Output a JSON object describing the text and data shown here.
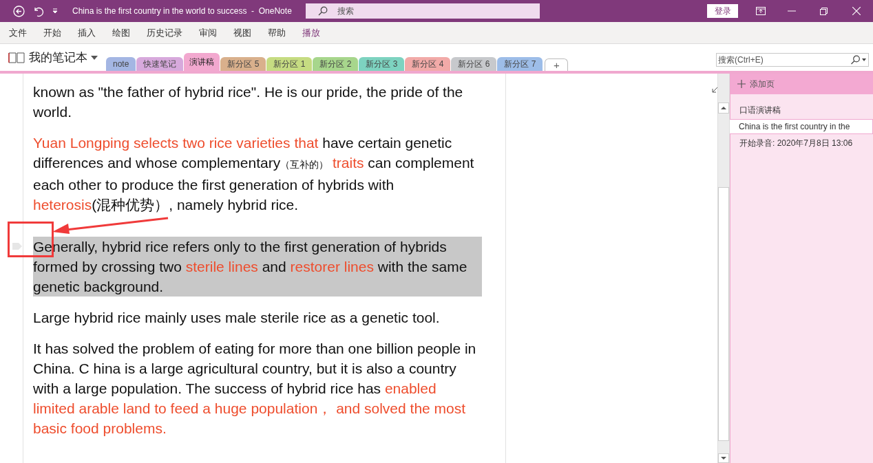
{
  "window": {
    "title": "China is the first country in the world to success  -  OneNote",
    "search_placeholder": "搜索",
    "sign_in": "登录"
  },
  "menu": [
    {
      "label": "文件",
      "selected": false
    },
    {
      "label": "开始",
      "selected": false
    },
    {
      "label": "插入",
      "selected": false
    },
    {
      "label": "绘图",
      "selected": false
    },
    {
      "label": "历史记录",
      "selected": false
    },
    {
      "label": "审阅",
      "selected": false
    },
    {
      "label": "视图",
      "selected": false
    },
    {
      "label": "帮助",
      "selected": false
    },
    {
      "label": "播放",
      "selected": true
    }
  ],
  "notebook": {
    "name": "我的笔记本"
  },
  "sections": [
    {
      "label": "note",
      "color": "#a4b6e3",
      "selected": false
    },
    {
      "label": "快速笔记",
      "color": "#d7a9dc",
      "selected": false
    },
    {
      "label": "演讲稿",
      "color": "#f2a8cf",
      "selected": true
    },
    {
      "label": "新分区 5",
      "color": "#d9b08c",
      "selected": false
    },
    {
      "label": "新分区 1",
      "color": "#c6dc82",
      "selected": false
    },
    {
      "label": "新分区 2",
      "color": "#a7d68c",
      "selected": false
    },
    {
      "label": "新分区 3",
      "color": "#7dd3c0",
      "selected": false
    },
    {
      "label": "新分区 4",
      "color": "#f2aaa8",
      "selected": false
    },
    {
      "label": "新分区 6",
      "color": "#c7c9cc",
      "selected": false
    },
    {
      "label": "新分区 7",
      "color": "#9dbde8",
      "selected": false
    }
  ],
  "add_section": "+",
  "page_search": {
    "placeholder": "搜索(Ctrl+E)"
  },
  "note": {
    "paragraphs": [
      {
        "selected": false,
        "runs": [
          {
            "text": "known as \"the father of hybrid rice\". He is our pride, the pride of the world.",
            "emphasis": false
          }
        ]
      },
      {
        "selected": false,
        "runs": [
          {
            "text": "Yuan Longping selects two rice varieties that",
            "emphasis": true
          },
          {
            "text": " have certain genetic differences and whose complementary",
            "emphasis": false
          },
          {
            "text": "（互补的）",
            "emphasis": false,
            "small": true
          },
          {
            "text": " traits",
            "emphasis": true
          },
          {
            "text": " can complement each other to produce the first generation of hybrids with ",
            "emphasis": false
          },
          {
            "text": "heterosis",
            "emphasis": true
          },
          {
            "text": "(混种优势）, namely hybrid rice.",
            "emphasis": false
          }
        ]
      },
      {
        "selected": true,
        "runs": [
          {
            "text": "Generally, hybrid rice refers only to the first generation of hybrids formed by crossing two ",
            "emphasis": false
          },
          {
            "text": "sterile lines",
            "emphasis": true
          },
          {
            "text": " and ",
            "emphasis": false
          },
          {
            "text": "restorer lines",
            "emphasis": true
          },
          {
            "text": " with the same genetic background.",
            "emphasis": false
          }
        ]
      },
      {
        "selected": false,
        "runs": [
          {
            "text": "Large hybrid rice mainly uses male sterile rice as a genetic tool.",
            "emphasis": false
          }
        ]
      },
      {
        "selected": false,
        "runs": [
          {
            "text": "It has solved the problem of eating for more than one billion people in China. C hina is a large agricultural country, but it is also a country with a large population. The success of hybrid rice has ",
            "emphasis": false
          },
          {
            "text": "enabled limited arable land to feed a huge population，    and solved the most basic food  problems.",
            "emphasis": true
          }
        ]
      }
    ]
  },
  "pages": {
    "add_page": "添加页",
    "items": [
      {
        "title": "口语演讲稿",
        "selected": false
      },
      {
        "title": "China is the first country in the",
        "selected": true
      },
      {
        "title": "开始录音: 2020年7月8日 13:06",
        "selected": false
      }
    ]
  }
}
